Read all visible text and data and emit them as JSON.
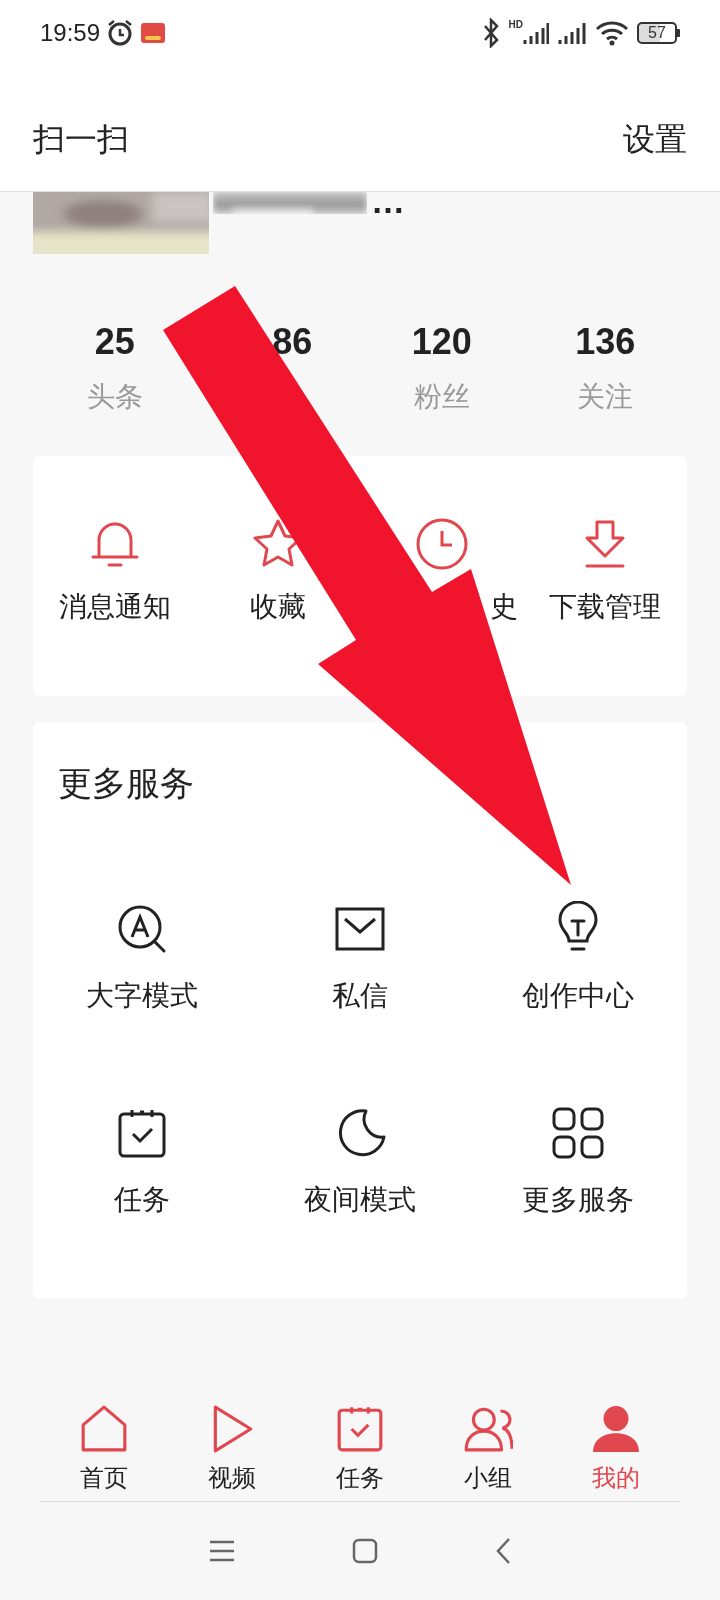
{
  "status_bar": {
    "time": "19:59",
    "hd_label": "HD",
    "battery": "57"
  },
  "header": {
    "left": "扫一扫",
    "right": "设置"
  },
  "profile": {
    "name": "…"
  },
  "stats": [
    {
      "value": "25",
      "label": "头条",
      "kind": "full"
    },
    {
      "value": "86",
      "kind": "partial"
    },
    {
      "value": "120",
      "label": "粉丝",
      "kind": "full"
    },
    {
      "value": "136",
      "label": "关注",
      "kind": "full"
    }
  ],
  "shortcuts": [
    {
      "label": "消息通知",
      "kind": "full"
    },
    {
      "label": "收藏",
      "kind": "full"
    },
    {
      "label": "史",
      "kind": "partial"
    },
    {
      "label": "下载管理",
      "kind": "full"
    }
  ],
  "services": {
    "title": "更多服务",
    "items": [
      {
        "label": "大字模式"
      },
      {
        "label": "私信"
      },
      {
        "label": "创作中心"
      },
      {
        "label": "任务"
      },
      {
        "label": "夜间模式"
      },
      {
        "label": "更多服务"
      }
    ]
  },
  "nav": [
    {
      "label": "首页",
      "selected": false
    },
    {
      "label": "视频",
      "selected": false
    },
    {
      "label": "任务",
      "selected": false
    },
    {
      "label": "小组",
      "selected": false
    },
    {
      "label": "我的",
      "selected": true
    }
  ]
}
